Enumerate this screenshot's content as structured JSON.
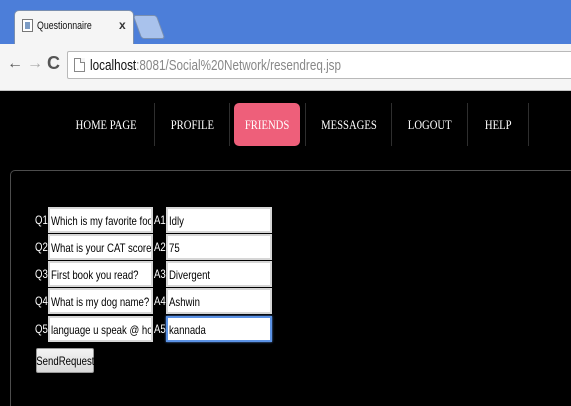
{
  "browser": {
    "tab_title": "Questionnaire",
    "tab_close": "x",
    "url_host": "localhost",
    "url_path": ":8081/Social%20Network/resendreq.jsp"
  },
  "nav": {
    "items": [
      {
        "label": "HOME PAGE",
        "active": false
      },
      {
        "label": "PROFILE",
        "active": false
      },
      {
        "label": "FRIENDS",
        "active": true
      },
      {
        "label": "MESSAGES",
        "active": false
      },
      {
        "label": "LOGOUT",
        "active": false
      },
      {
        "label": "HELP",
        "active": false
      }
    ],
    "active_color": "#ee5f7a"
  },
  "form": {
    "rows": [
      {
        "q_label": "Q1:",
        "question": "Which is my favorite food?",
        "a_label": "A1:",
        "answer": "Idly"
      },
      {
        "q_label": "Q2:",
        "question": "What is your CAT score?",
        "a_label": "A2:",
        "answer": "75"
      },
      {
        "q_label": "Q3:",
        "question": "First book you read?",
        "a_label": "A3:",
        "answer": "Divergent"
      },
      {
        "q_label": "Q4:",
        "question": "What is my dog name?",
        "a_label": "A4:",
        "answer": "Ashwin"
      },
      {
        "q_label": "Q5:",
        "question": "language u speak @ home?",
        "a_label": "A5:",
        "answer": "kannada"
      }
    ],
    "submit_label": "SendRequest"
  }
}
